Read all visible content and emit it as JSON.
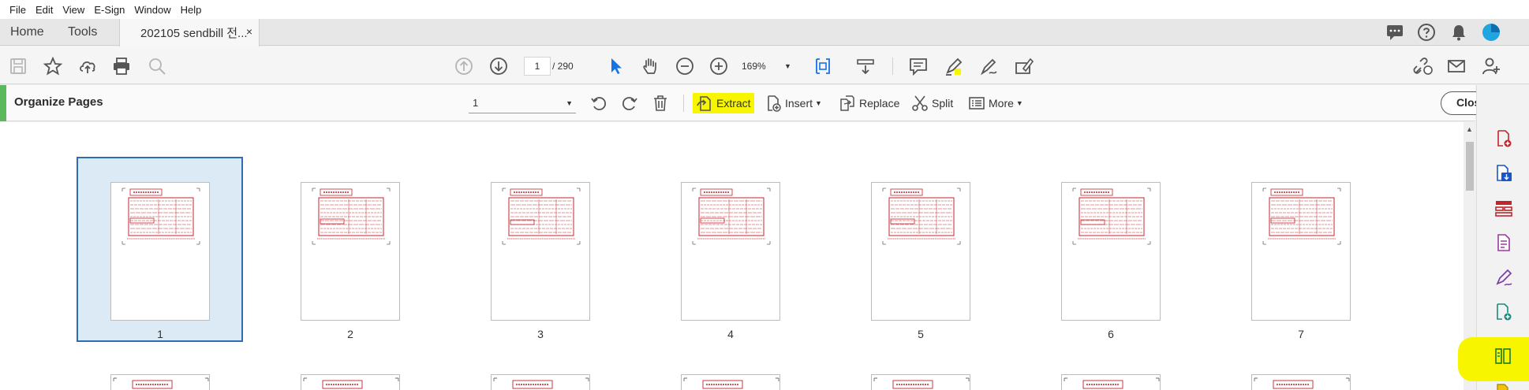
{
  "menu": [
    "File",
    "Edit",
    "View",
    "E-Sign",
    "Window",
    "Help"
  ],
  "tabs": {
    "home": "Home",
    "tools": "Tools",
    "document": "202105 sendbill 전...",
    "close_symbol": "×"
  },
  "toolbar": {
    "current_page": "1",
    "total_pages": "/ 290",
    "zoom": "169%"
  },
  "organize": {
    "title": "Organize Pages",
    "page_range": "1",
    "extract_label": "Extract",
    "insert_label": "Insert",
    "replace_label": "Replace",
    "split_label": "Split",
    "more_label": "More",
    "close_label": "Close"
  },
  "thumbnails": [
    "1",
    "2",
    "3",
    "4",
    "5",
    "6",
    "7"
  ],
  "colors": {
    "highlight": "#f7f500",
    "accent_green": "#5cb85c",
    "selection": "#2e6db4",
    "page_red": "#c0262d"
  }
}
